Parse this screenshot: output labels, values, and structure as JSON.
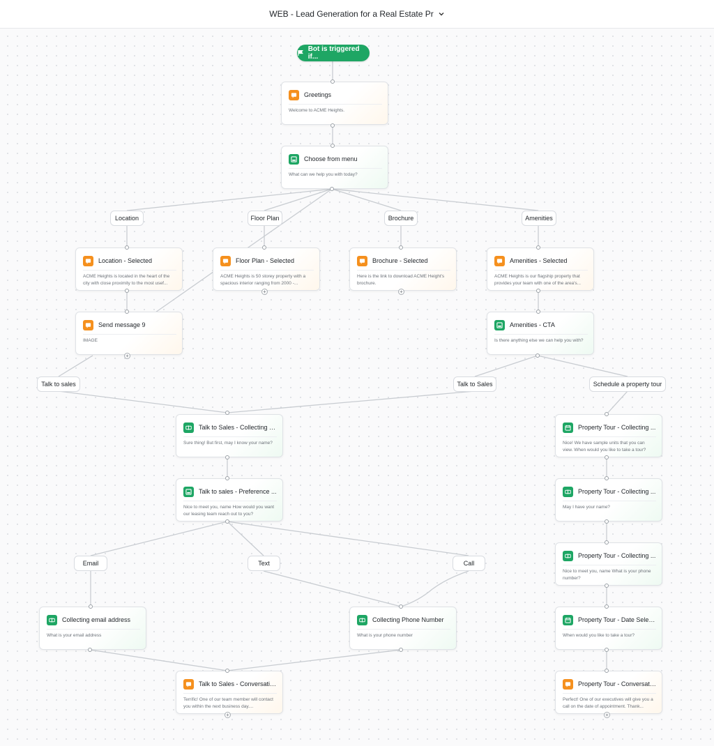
{
  "header": {
    "title": "WEB - Lead Generation for a Real Estate Pr"
  },
  "trigger": {
    "label": "Bot is triggered if..."
  },
  "nodes": {
    "greetings": {
      "title": "Greetings",
      "desc": "Welcome to ACME Heights."
    },
    "menu": {
      "title": "Choose from menu",
      "desc": "What can we help you with today?"
    },
    "location": {
      "title": "Location - Selected",
      "desc": "ACME Heights is located in the heart of the city with close proximity to the most usef..."
    },
    "floorplan": {
      "title": "Floor Plan - Selected",
      "desc": "ACME Heights is 50 storey property with a spacious interior ranging from 2000 -..."
    },
    "brochure": {
      "title": "Brochure - Selected",
      "desc": "Here is the link to download ACME Height's brochure."
    },
    "amenities": {
      "title": "Amenities - Selected",
      "desc": "ACME Heights is our flagship property that provides your team with one of the area's..."
    },
    "send9": {
      "title": "Send message 9",
      "desc": "IMAGE"
    },
    "amenities_cta": {
      "title": "Amenities - CTA",
      "desc": "Is there anything else we can help you with?"
    },
    "sales_name": {
      "title": "Talk to Sales - Collecting N...",
      "desc": "Sure thing! But first, may I know your name?"
    },
    "sales_pref": {
      "title": "Talk to sales - Preference ...",
      "desc": "Nice to meet you, name How would you want our leasing team reach out to you?"
    },
    "email": {
      "title": "Collecting email address",
      "desc": "What is your email address"
    },
    "phone": {
      "title": "Collecting Phone Number",
      "desc": "What is your phone number"
    },
    "sales_conv": {
      "title": "Talk to Sales - Conversatio...",
      "desc": "Terrific! One of our team member will contact you within the next business day...."
    },
    "tour1": {
      "title": "Property Tour - Collecting ...",
      "desc": "Nice! We have sample units that you can view. When would you like to take a tour?"
    },
    "tour2": {
      "title": "Property Tour - Collecting ...",
      "desc": "May I have your name?"
    },
    "tour3": {
      "title": "Property Tour - Collecting ...",
      "desc": "Nice to meet you, name What is your phone number?"
    },
    "tour_date": {
      "title": "Property Tour - Date Selec...",
      "desc": "When would you like to take a tour?"
    },
    "tour_conv": {
      "title": "Property Tour - Conversati...",
      "desc": "Perfect! One of our executives will give you a call on the date of appointment. Thank..."
    }
  },
  "options": {
    "location": "Location",
    "floorplan": "Floor Plan",
    "brochure": "Brochure",
    "amenities": "Amenities",
    "talk_sales_left": "Talk to sales",
    "talk_sales_right": "Talk to Sales",
    "schedule_tour": "Schedule a property tour",
    "email": "Email",
    "text": "Text",
    "call": "Call"
  },
  "colors": {
    "accent_green": "#1ea664",
    "accent_orange": "#f5901e",
    "edge": "#c8ccd1"
  },
  "icons": {
    "trigger": "flag-icon",
    "message": "chat-bubble-icon",
    "menu": "menu-card-icon",
    "collect": "input-field-icon",
    "date": "calendar-icon",
    "dropdown": "chevron-down-icon",
    "add": "plus-icon"
  }
}
